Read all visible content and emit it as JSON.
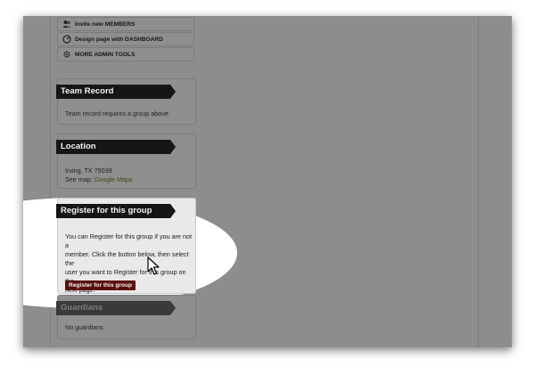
{
  "admin_tools": [
    {
      "label": "Invite new MEMBERS",
      "icon": "invite-icon"
    },
    {
      "label": "Design page with DASHBOARD",
      "icon": "dashboard-icon"
    },
    {
      "label": "MORE ADMIN TOOLS",
      "icon": "gear-icon"
    }
  ],
  "team_record": {
    "title": "Team Record",
    "text": "Team record requires a group above."
  },
  "location": {
    "title": "Location",
    "address": "Irving, TX 75039",
    "map_prefix": "See map: ",
    "map_link": "Google Maps"
  },
  "register": {
    "title": "Register for this group",
    "lines": [
      "You can Register for this group if you are not a",
      "member. Click the button below, then select the",
      "user you want to Register for this group on the",
      "next page."
    ],
    "button_label": "Register for this group"
  },
  "guardians": {
    "title": "Guardians",
    "text": "No guardians"
  },
  "colors": {
    "page_overlay": "#8d8d8d",
    "spotlight": "#ffffff",
    "banner": "#161616",
    "button": "#5a0e0e",
    "link": "#3b4e0e"
  }
}
